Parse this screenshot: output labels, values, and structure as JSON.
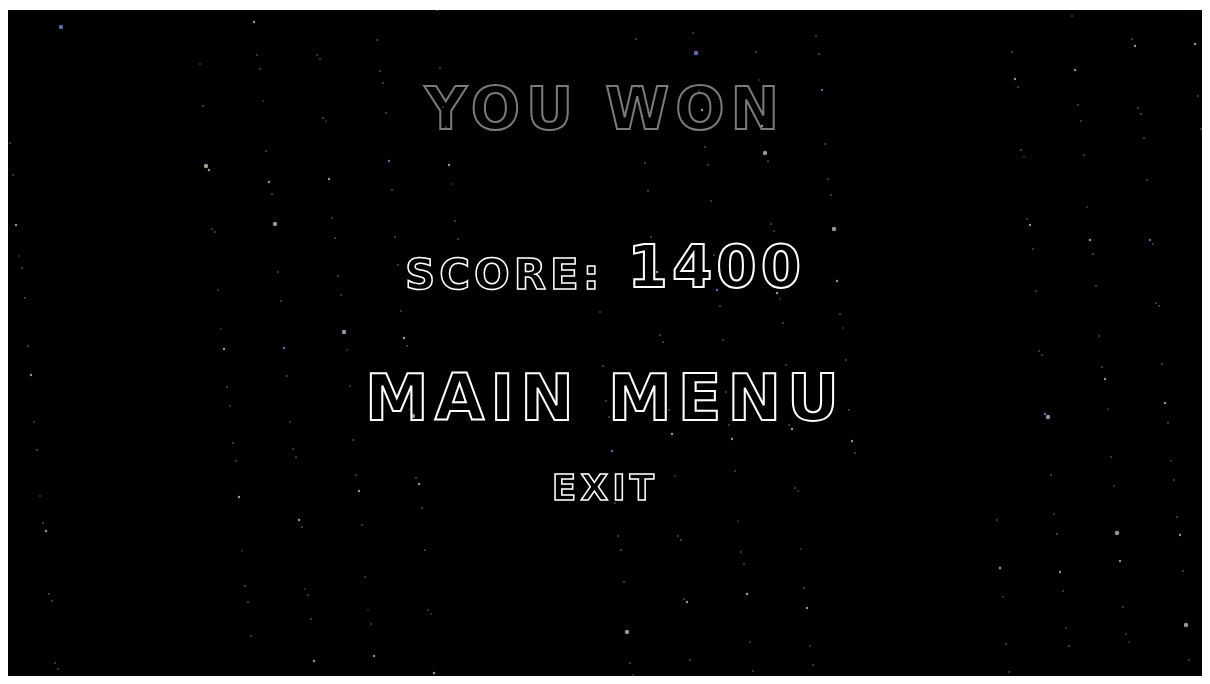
{
  "title": "YOU WON",
  "score": {
    "label": "SCORE:",
    "value": "1400"
  },
  "menu": [
    {
      "label": "MAIN MENU",
      "kind": "primary"
    },
    {
      "label": "EXIT",
      "kind": "secondary"
    }
  ]
}
